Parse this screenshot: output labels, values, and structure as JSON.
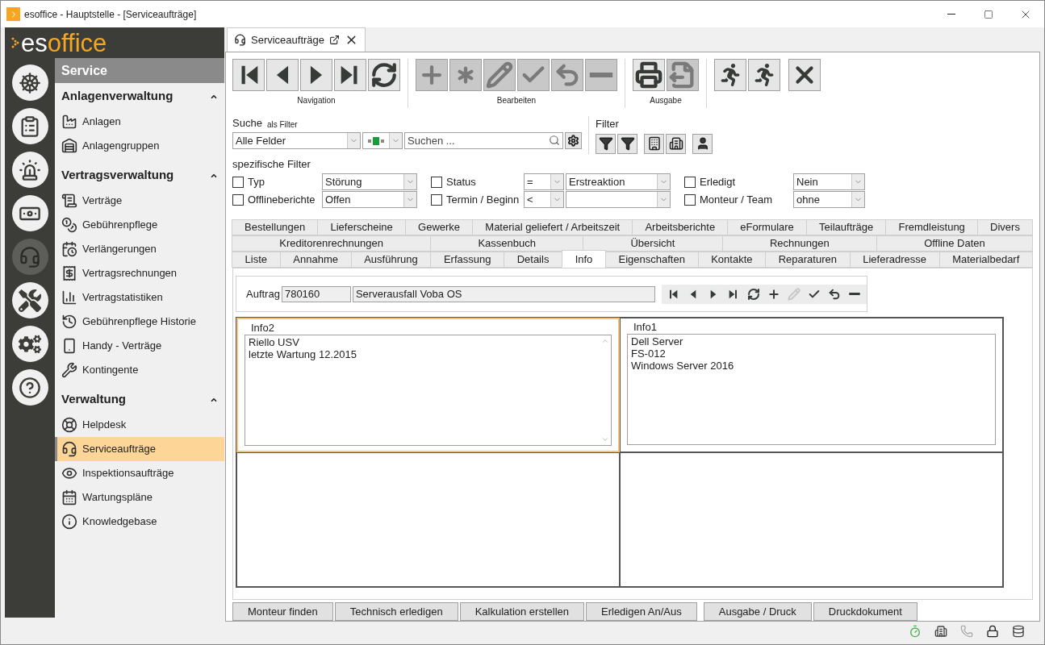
{
  "window": {
    "title": "esoffice - Hauptstelle - [Serviceaufträge]"
  },
  "logo": {
    "part_1": "es",
    "part_2": "office"
  },
  "rail": [
    {
      "kind": "helm",
      "selected": false
    },
    {
      "kind": "planner",
      "selected": false
    },
    {
      "kind": "siren",
      "selected": false
    },
    {
      "kind": "money",
      "selected": false
    },
    {
      "kind": "headset",
      "selected": true
    },
    {
      "kind": "tools",
      "selected": false
    },
    {
      "kind": "gears",
      "selected": false
    },
    {
      "kind": "help",
      "selected": false
    }
  ],
  "sidebar": {
    "title": "Service",
    "sections": [
      {
        "title": "Anlagenverwaltung",
        "expanded": true,
        "items": [
          {
            "label": "Anlagen",
            "kind": "factory",
            "selected": false
          },
          {
            "label": "Anlagengruppen",
            "kind": "warehouse",
            "selected": false
          }
        ]
      },
      {
        "title": "Vertragsverwaltung",
        "expanded": true,
        "items": [
          {
            "label": "Verträge",
            "kind": "scroll",
            "selected": false
          },
          {
            "label": "Gebührenpflege",
            "kind": "coins",
            "selected": false
          },
          {
            "label": "Verlängerungen",
            "kind": "clock",
            "selected": false
          },
          {
            "label": "Vertragsrechnungen",
            "kind": "receipt",
            "selected": false
          },
          {
            "label": "Vertragstatistiken",
            "kind": "chart",
            "selected": false
          },
          {
            "label": "Gebührenpflege Historie",
            "kind": "history",
            "selected": false
          },
          {
            "label": "Handy - Verträge",
            "kind": "phone",
            "selected": false
          },
          {
            "label": "Kontingente",
            "kind": "wrench",
            "selected": false
          }
        ]
      },
      {
        "title": "Verwaltung",
        "expanded": true,
        "items": [
          {
            "label": "Helpdesk",
            "kind": "lifebuoy",
            "selected": false
          },
          {
            "label": "Serviceaufträge",
            "kind": "headset",
            "selected": true
          },
          {
            "label": "Inspektionsaufträge",
            "kind": "eye",
            "selected": false
          },
          {
            "label": "Wartungspläne",
            "kind": "calendar",
            "selected": false
          },
          {
            "label": "Knowledgebase",
            "kind": "info",
            "selected": false
          }
        ]
      }
    ]
  },
  "doc_tab": {
    "label": "Serviceaufträge"
  },
  "toolbar": [
    {
      "label": "Navigation",
      "buttons": [
        {
          "kind": "first",
          "disabled": false
        },
        {
          "kind": "prev",
          "disabled": false
        },
        {
          "kind": "next",
          "disabled": false
        },
        {
          "kind": "last",
          "disabled": false
        },
        {
          "kind": "refresh",
          "disabled": false
        }
      ]
    },
    {
      "label": "Bearbeiten",
      "buttons": [
        {
          "kind": "plus",
          "disabled": true
        },
        {
          "kind": "asterisk",
          "disabled": true
        },
        {
          "kind": "pencil",
          "disabled": true
        },
        {
          "kind": "check",
          "disabled": true
        },
        {
          "kind": "undo",
          "disabled": true
        },
        {
          "kind": "minus",
          "disabled": true
        }
      ]
    },
    {
      "label": "Ausgabe",
      "buttons": [
        {
          "kind": "printer",
          "disabled": false
        },
        {
          "kind": "export",
          "disabled": true
        }
      ]
    },
    {
      "buttons": [
        {
          "kind": "runner",
          "disabled": false
        },
        {
          "kind": "runner",
          "disabled": false
        },
        {
          "kind": "close",
          "disabled": false
        }
      ]
    }
  ],
  "search": {
    "label": "Suche",
    "sublabel": "als Filter",
    "field": "Alle Felder",
    "placeholder": "Suchen ..."
  },
  "filter": {
    "label": "Filter",
    "buttons": [
      {
        "kind": "funnel-edit"
      },
      {
        "kind": "funnel-check"
      },
      {
        "kind": "building-funnel"
      },
      {
        "kind": "buildings-funnel"
      },
      {
        "kind": "user"
      }
    ]
  },
  "specific_filters": {
    "title": "spezifische Filter",
    "columns": [
      [
        {
          "label": "Typ",
          "checked": false,
          "value": "Störung"
        },
        {
          "label": "Offlineberichte",
          "checked": false,
          "value": "Offen"
        }
      ],
      [
        {
          "label": "Status",
          "checked": false,
          "operator": "=",
          "value": "Erstreaktion"
        },
        {
          "label": "Termin / Beginn",
          "checked": false,
          "operator": "<"
        }
      ],
      [
        {
          "label": "Erledigt",
          "checked": false,
          "value": "Nein"
        },
        {
          "label": "Monteur / Team",
          "checked": false,
          "value": "ohne"
        }
      ]
    ]
  },
  "tab_rows": [
    {
      "tabs": [
        {
          "label": "Bestellungen",
          "selected": false
        },
        {
          "label": "Lieferscheine",
          "selected": false
        },
        {
          "label": "Gewerke",
          "selected": false
        },
        {
          "label": "Material geliefert / Arbeitszeit",
          "selected": false
        },
        {
          "label": "Arbeitsberichte",
          "selected": false
        },
        {
          "label": "eFormulare",
          "selected": false
        },
        {
          "label": "Teilaufträge",
          "selected": false
        },
        {
          "label": "Fremdleistung",
          "selected": false
        },
        {
          "label": "Divers",
          "selected": false
        }
      ]
    },
    {
      "tabs": [
        {
          "label": "Kreditorenrechnungen",
          "selected": false
        },
        {
          "label": "Kassenbuch",
          "selected": false
        },
        {
          "label": "Übersicht",
          "selected": false
        },
        {
          "label": "Rechnungen",
          "selected": false
        },
        {
          "label": "Offline Daten",
          "selected": false
        }
      ]
    },
    {
      "tabs": [
        {
          "label": "Liste",
          "selected": false
        },
        {
          "label": "Annahme",
          "selected": false
        },
        {
          "label": "Ausführung",
          "selected": false
        },
        {
          "label": "Erfassung",
          "selected": false
        },
        {
          "label": "Details",
          "selected": false
        },
        {
          "label": "Info",
          "selected": true
        },
        {
          "label": "Eigenschaften",
          "selected": false
        },
        {
          "label": "Kontakte",
          "selected": false
        },
        {
          "label": "Reparaturen",
          "selected": false
        },
        {
          "label": "Lieferadresse",
          "selected": false
        },
        {
          "label": "Materialbedarf",
          "selected": false
        }
      ]
    }
  ],
  "order": {
    "label": "Auftrag",
    "number": "780160",
    "description": "Serverausfall Voba OS",
    "toolbar": [
      {
        "kind": "first",
        "disabled": false
      },
      {
        "kind": "prev",
        "disabled": false
      },
      {
        "kind": "next",
        "disabled": false
      },
      {
        "kind": "last",
        "disabled": false
      },
      {
        "kind": "refresh",
        "disabled": false
      },
      {
        "kind": "plus",
        "disabled": false
      },
      {
        "kind": "pencil",
        "disabled": true
      },
      {
        "kind": "check",
        "disabled": false
      },
      {
        "kind": "undo",
        "disabled": false
      },
      {
        "kind": "minus",
        "disabled": false
      }
    ]
  },
  "info_panels": [
    {
      "title": "Info2",
      "focused": true,
      "scrollbar": true,
      "lines": [
        "Riello USV",
        "letzte Wartung 12.2015"
      ]
    },
    {
      "title": "Info1",
      "focused": false,
      "scrollbar": false,
      "lines": [
        "Dell Server",
        "FS-012",
        "Windows Server 2016"
      ]
    }
  ],
  "buttons": [
    "Monteur finden",
    "Technisch erledigen",
    "Kalkulation erstellen",
    "Erledigen An/Aus",
    "Ausgabe / Druck",
    "Druckdokument"
  ],
  "status_bar": [
    {
      "kind": "stopwatch"
    },
    {
      "kind": "building"
    },
    {
      "kind": "phone",
      "disabled": true
    },
    {
      "kind": "lock"
    },
    {
      "kind": "database"
    }
  ]
}
